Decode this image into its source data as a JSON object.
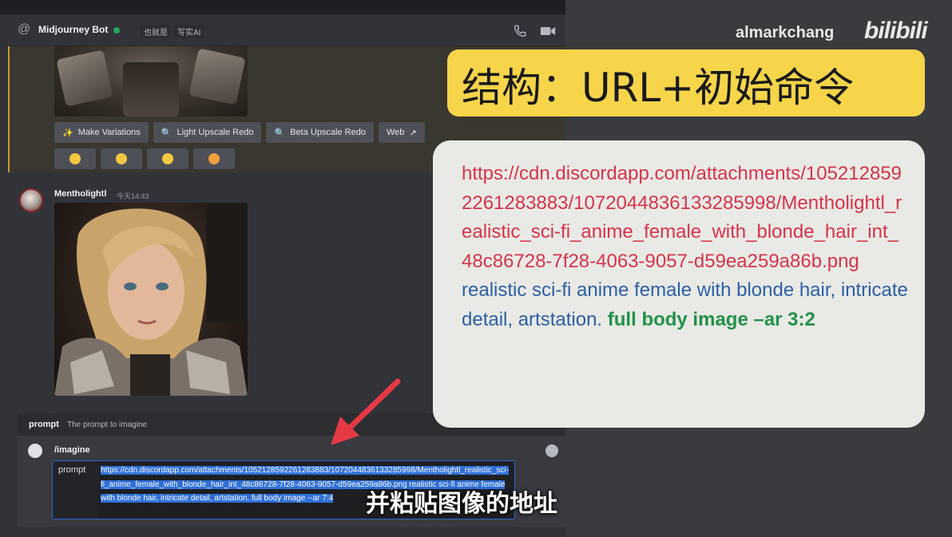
{
  "header": {
    "bot_name": "Midjourney Bot",
    "tags": [
      "也就是",
      "写实AI"
    ]
  },
  "prev_message": {
    "buttons": [
      "Make Variations",
      "Light Upscale Redo",
      "Beta Upscale Redo",
      "Web"
    ],
    "reactions": [
      "tired-face",
      "unamused-face",
      "smiley-face",
      "heart-eyes-face"
    ]
  },
  "message": {
    "author": "Mentholightl",
    "timestamp": "今天14:43"
  },
  "prompt_hint": {
    "key": "prompt",
    "description": "The prompt to imagine"
  },
  "command": {
    "name": "/imagine",
    "option_label": "prompt",
    "option_value": "https://cdn.discordapp.com/attachments/1052128592261283883/1072044836133285998/Mentholightl_realistic_sci-fi_anime_female_with_blonde_hair_int_48c86728-7f28-4063-9057-d59ea259a86b.png realistic sci-fi anime female with blonde hair, intricate detail, artstation. full body image --ar 7:4"
  },
  "watermark": {
    "user": "almarkchang",
    "brand": "bilibili"
  },
  "title": "结构：URL+初始命令",
  "info": {
    "url": "https://cdn.discordapp.com/attachments/1052128592261283883/1072044836133285998/Mentholightl_realistic_sci-fi_anime_female_with_blonde_hair_int_48c86728-7f28-4063-9057-d59ea259a86b.png",
    "description": "realistic sci-fi anime female with blonde hair, intricate detail, artstation.",
    "params": "full body image –ar 3:2"
  },
  "subtitle": "并粘贴图像的地址",
  "colors": {
    "title_bg": "#f6d54a",
    "url": "#d6334a",
    "description": "#2d5fa5",
    "params": "#219247",
    "arrow": "#e63946",
    "selection": "#2f6fd8"
  }
}
